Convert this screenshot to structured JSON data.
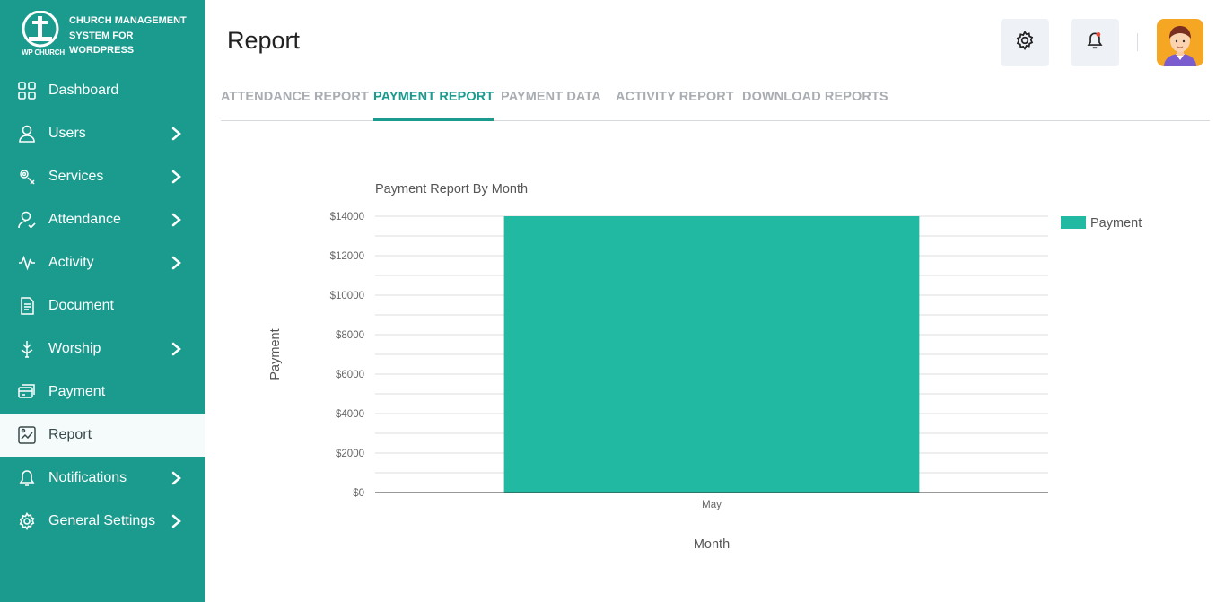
{
  "brand": {
    "logo_text": "CHURCH MANAGEMENT SYSTEM FOR WORDPRESS",
    "logo_sub": "WP CHURCH"
  },
  "sidebar": {
    "items": [
      {
        "label": "Dashboard",
        "icon": "dashboard-icon",
        "chevron": false
      },
      {
        "label": "Users",
        "icon": "user-icon",
        "chevron": true
      },
      {
        "label": "Services",
        "icon": "services-icon",
        "chevron": true
      },
      {
        "label": "Attendance",
        "icon": "attendance-icon",
        "chevron": true
      },
      {
        "label": "Activity",
        "icon": "activity-icon",
        "chevron": true
      },
      {
        "label": "Document",
        "icon": "document-icon",
        "chevron": false
      },
      {
        "label": "Worship",
        "icon": "worship-icon",
        "chevron": true
      },
      {
        "label": "Payment",
        "icon": "payment-icon",
        "chevron": false
      },
      {
        "label": "Report",
        "icon": "report-icon",
        "chevron": false,
        "active": true
      },
      {
        "label": "Notifications",
        "icon": "bell-icon",
        "chevron": true
      },
      {
        "label": "General Settings",
        "icon": "gear-icon",
        "chevron": true
      }
    ]
  },
  "header": {
    "title": "Report",
    "settings_icon": "gear-icon",
    "notification_icon": "bell-icon",
    "avatar_icon": "avatar"
  },
  "tabs": [
    {
      "label": "ATTENDANCE REPORT"
    },
    {
      "label": "PAYMENT REPORT",
      "active": true
    },
    {
      "label": "PAYMENT DATA"
    },
    {
      "label": "ACTIVITY REPORT"
    },
    {
      "label": "DOWNLOAD REPORTS"
    }
  ],
  "colors": {
    "primary": "#1a9b8e",
    "bar": "#22b9a2",
    "notification_dot": "#e74c3c"
  },
  "chart_data": {
    "type": "bar",
    "title": "Payment Report By Month",
    "xlabel": "Month",
    "ylabel": "Payment",
    "categories": [
      "May"
    ],
    "series": [
      {
        "name": "Payment",
        "values": [
          14000
        ]
      }
    ],
    "ylim": [
      0,
      14000
    ],
    "yticks": [
      "$0",
      "$2000",
      "$4000",
      "$6000",
      "$8000",
      "$10000",
      "$12000",
      "$14000"
    ],
    "grid": true,
    "legend": "top-right"
  }
}
